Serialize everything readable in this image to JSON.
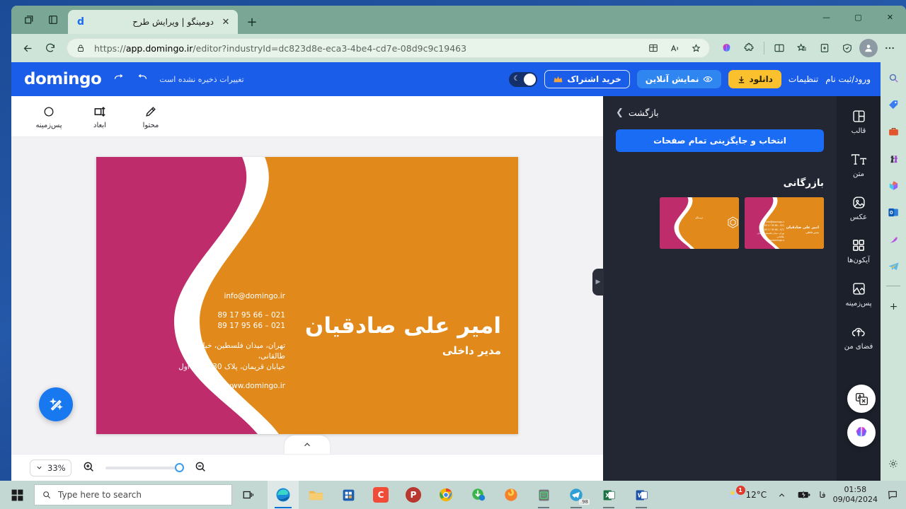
{
  "browser": {
    "tab": {
      "title": "دومینگو | ویرایش طرح",
      "favicon": "d",
      "close_icon": "close-icon"
    },
    "new_tab_label": "+",
    "window_controls": {
      "minimize": "—",
      "maximize": "▢",
      "close": "✕"
    },
    "nav": {
      "back": "←",
      "refresh": "⟳"
    },
    "url": {
      "scheme": "https://",
      "host": "app.domingo.ir",
      "path": "/editor?industryId=dc823d8e-eca3-4be4-cd7e-08d9c9c19463"
    },
    "toolbar_icons": [
      "split-screen-icon",
      "read-aloud-icon",
      "favorite-star-icon",
      "collections-icon",
      "copilot-icon",
      "extensions-icon",
      "browser-essentials-icon",
      "profile-avatar",
      "settings-more-icon"
    ],
    "rail_icons": [
      "search-icon",
      "shopping-tag-icon",
      "tools-icon",
      "games-icon",
      "office-icon",
      "outlook-icon",
      "image-tools-icon",
      "telegram-icon",
      "add-icon",
      "settings-icon"
    ]
  },
  "app": {
    "brand": "domingo",
    "save_status": "تغییرات ذخیره نشده است",
    "undo_icon": "undo-icon",
    "redo_icon": "redo-icon",
    "header": {
      "login": "ورود/ثبت نام",
      "settings": "تنظیمات",
      "download": "دانلود",
      "preview": "نمایش آنلاین",
      "subscribe": "خرید اشتراک",
      "theme_toggle": "theme-toggle"
    },
    "tools": [
      {
        "label": "محتوا",
        "icon": "pencil-icon"
      },
      {
        "label": "ابعاد",
        "icon": "dimensions-icon"
      },
      {
        "label": "پس‌زمینه",
        "icon": "background-circle-icon"
      }
    ],
    "zoom": {
      "value": "33%",
      "zoom_in": "zoom-in-icon",
      "zoom_out": "zoom-out-icon",
      "caret": "chevron-down-icon"
    },
    "page_caret": "chevron-up-icon",
    "magic_button": "magic-wand-icon",
    "panel_handle": "panel-collapse-icon",
    "panel": {
      "back": "بازگشت",
      "back_chevron": "❯",
      "replace_all": "انتخاب و جایگزینی تمام صفحات",
      "section_title": "بازرگانی",
      "thumbs": [
        {
          "name": "امیر علی صادقیان",
          "role": "مدیر داخلی",
          "kind": "front"
        },
        {
          "logo_text": "دومینگو",
          "kind": "back"
        }
      ]
    },
    "rail": [
      {
        "label": "قالب",
        "icon": "template-icon"
      },
      {
        "label": "متن",
        "icon": "text-icon"
      },
      {
        "label": "عکس",
        "icon": "image-icon"
      },
      {
        "label": "آیکون‌ها",
        "icon": "icons-grid-icon"
      },
      {
        "label": "پس‌زمینه",
        "icon": "background-icon"
      },
      {
        "label": "فضای من",
        "icon": "cloud-upload-icon"
      }
    ],
    "bubbles": [
      {
        "name": "translate-bubble",
        "icon": "translate-icon"
      },
      {
        "name": "ai-assistant-bubble",
        "icon": "brain-icon"
      }
    ],
    "card": {
      "name": "امیر علی صادقیان",
      "role": "مدیر داخلی",
      "email": "info@domingo.ir",
      "phone1": "021 – 66 95 17 89",
      "phone2": "021 – 66 95 17 89",
      "address1": "تهران، میدان فلسطین، خیابان طالقانی،",
      "address2": "خیابان قریمان، پلاک 30، طبقه اول",
      "website": "www.domingo.ir",
      "colors": {
        "magenta": "#bf2c6b",
        "orange": "#e2891b",
        "teal": "#13424a",
        "white": "#ffffff"
      }
    }
  },
  "taskbar": {
    "start": "start-icon",
    "search_placeholder": "Type here to search",
    "task_view": "task-view-icon",
    "apps": [
      {
        "name": "edge",
        "label": "e"
      },
      {
        "name": "file-explorer",
        "label": ""
      },
      {
        "name": "microsoft-store",
        "label": ""
      },
      {
        "name": "clipchamp",
        "label": "C"
      },
      {
        "name": "photoshop-p",
        "label": "P"
      },
      {
        "name": "chrome",
        "label": ""
      },
      {
        "name": "idm",
        "label": ""
      },
      {
        "name": "firefox",
        "label": ""
      },
      {
        "name": "notepad-green",
        "label": ""
      },
      {
        "name": "telegram",
        "label": ".98"
      },
      {
        "name": "excel",
        "label": "X"
      },
      {
        "name": "word",
        "label": "W"
      }
    ],
    "weather": {
      "temp": "12°C",
      "badge": "1"
    },
    "language": "فا",
    "time": "01:58",
    "date": "09/04/2024",
    "notification": "notification-icon"
  }
}
